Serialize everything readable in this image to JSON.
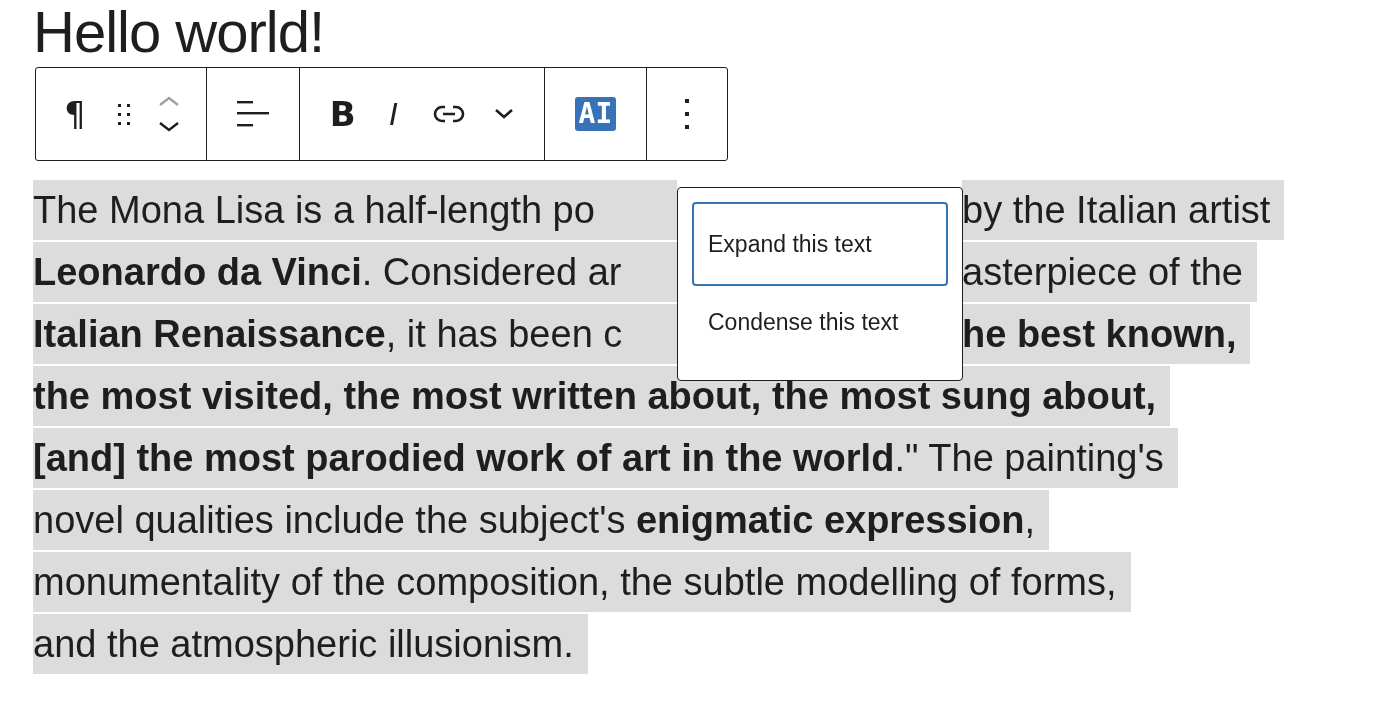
{
  "title": "Hello world!",
  "toolbar": [
    {
      "items": [
        {
          "kind": "glyph",
          "label": "¶"
        },
        {
          "kind": "drag"
        },
        {
          "kind": "movers",
          "moves": [
            {
              "disabled": true
            },
            {
              "disabled": false
            }
          ]
        }
      ]
    },
    {
      "items": [
        {
          "kind": "align"
        }
      ]
    },
    {
      "items": [
        {
          "kind": "glyph",
          "label": "B"
        },
        {
          "kind": "glyph",
          "label": "I"
        },
        {
          "kind": "link"
        },
        {
          "kind": "chevron"
        }
      ]
    },
    {
      "items": [
        {
          "kind": "badge",
          "label": "AI"
        }
      ]
    },
    {
      "items": [
        {
          "kind": "more"
        }
      ]
    }
  ],
  "paragraph": {
    "lines": [
      {
        "left": "The Mona Lisa is a half-length po",
        "right": "by the Italian artist"
      },
      {
        "left": "**Leonardo da Vinci**. Considered ar",
        "right": "asterpiece of the"
      },
      {
        "left": "**Italian Renaissance**, it has been c",
        "right": "**he best known,**"
      },
      {
        "text": "**the most visited, the most written about, the most sung about,**"
      },
      {
        "text": "**[and] the most parodied work of art in the world**.\" The painting's"
      },
      {
        "text": "novel qualities include the subject's **enigmatic expression**,"
      },
      {
        "text": "monumentality of the composition, the subtle modelling of forms,"
      },
      {
        "text": "and the atmospheric illusionism."
      }
    ]
  },
  "popover": {
    "items": [
      {
        "label": "Expand this text",
        "selected": true
      },
      {
        "label": "Condense this text",
        "selected": false
      }
    ]
  }
}
